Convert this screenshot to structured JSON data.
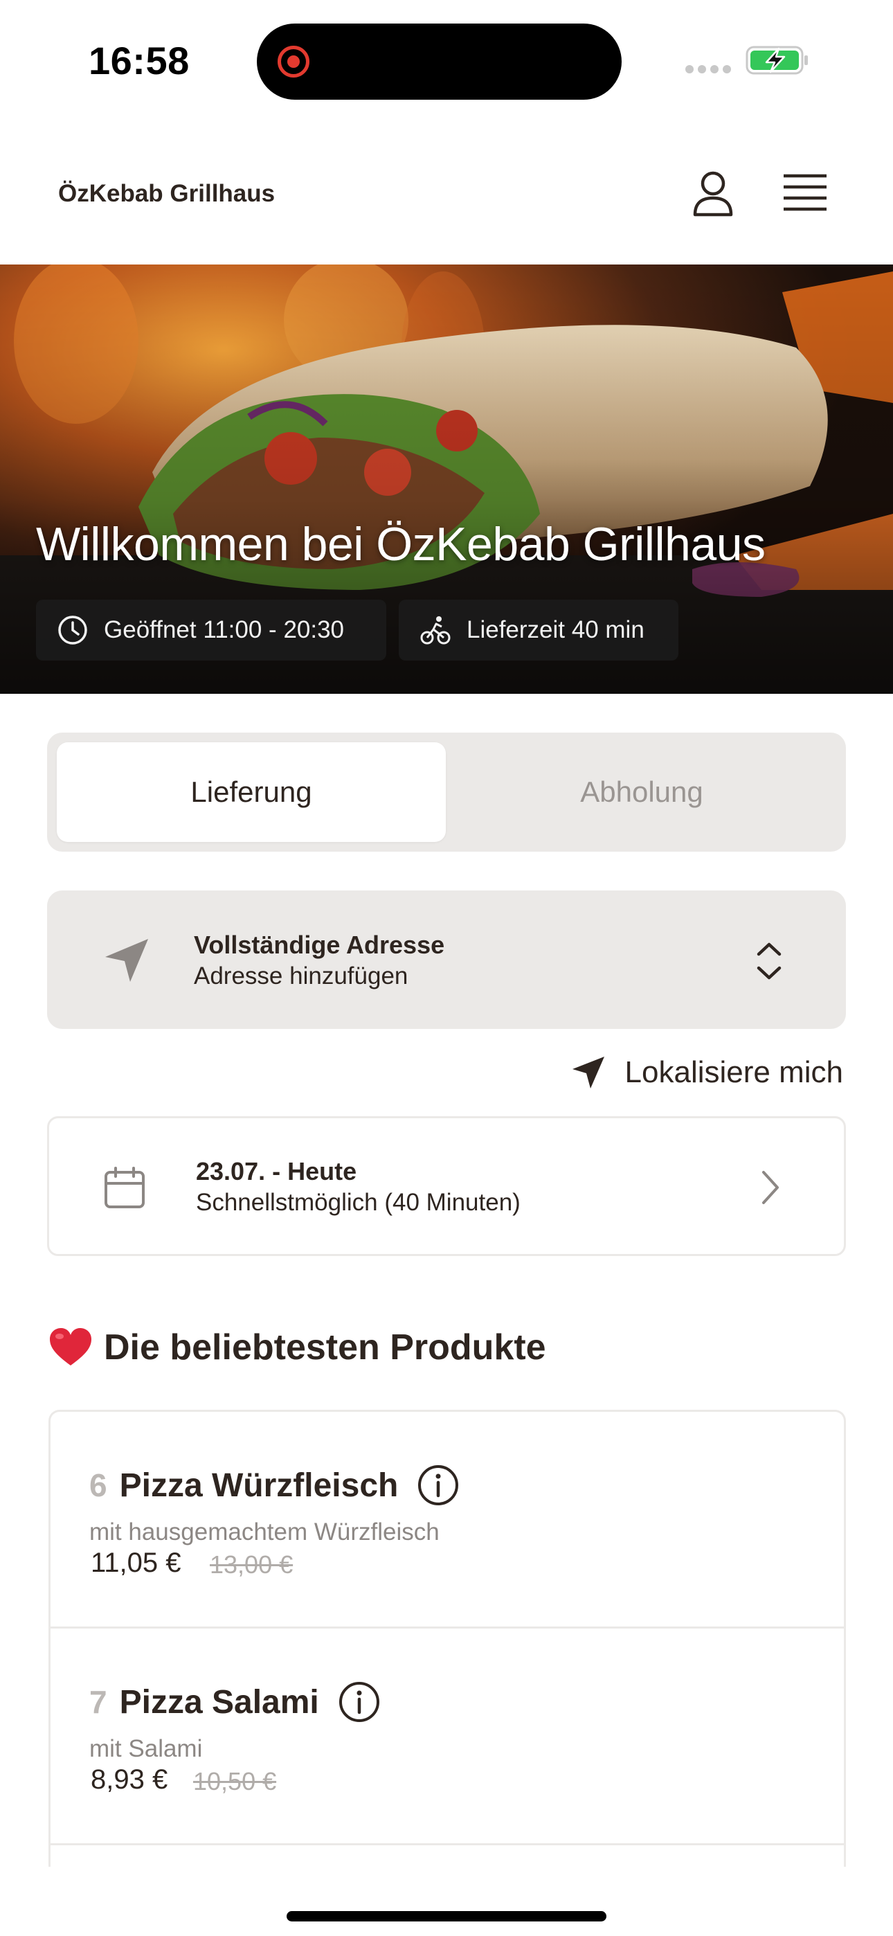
{
  "status_bar": {
    "time": "16:58",
    "icons": [
      "screen-recording-icon",
      "signal-icon",
      "battery-charging-icon"
    ],
    "battery_color": "#34c759"
  },
  "header": {
    "brand": "ÖzKebab Grillhaus",
    "icons": [
      "user-icon",
      "menu-icon"
    ]
  },
  "hero": {
    "title": "Willkommen bei ÖzKebab Grillhaus",
    "opening_hours": "Geöffnet 11:00 - 20:30",
    "delivery_time": "Lieferzeit 40 min",
    "icons": [
      "clock-icon",
      "bicycle-icon"
    ]
  },
  "mode_toggle": {
    "options": [
      "Lieferung",
      "Abholung"
    ],
    "selected": "Lieferung"
  },
  "address": {
    "title": "Vollständige Adresse",
    "placeholder": "Adresse hinzufügen",
    "locate_label": "Lokalisiere mich"
  },
  "schedule": {
    "date": "23.07. - Heute",
    "time": "Schnellstmöglich (40 Minuten)"
  },
  "popular": {
    "title": "Die beliebtesten Produkte",
    "emoji": "heart-icon",
    "products": [
      {
        "number": "6",
        "name": "Pizza Würzfleisch",
        "description": "mit hausgemachtem Würzfleisch",
        "price": "11,05 €",
        "old_price": "13,00 €"
      },
      {
        "number": "7",
        "name": "Pizza Salami",
        "description": "mit Salami",
        "price": "8,93 €",
        "old_price": "10,50 €"
      }
    ]
  },
  "colors": {
    "text": "#2e2520",
    "surface_gray": "#ebe9e7",
    "muted": "#9a9592"
  }
}
